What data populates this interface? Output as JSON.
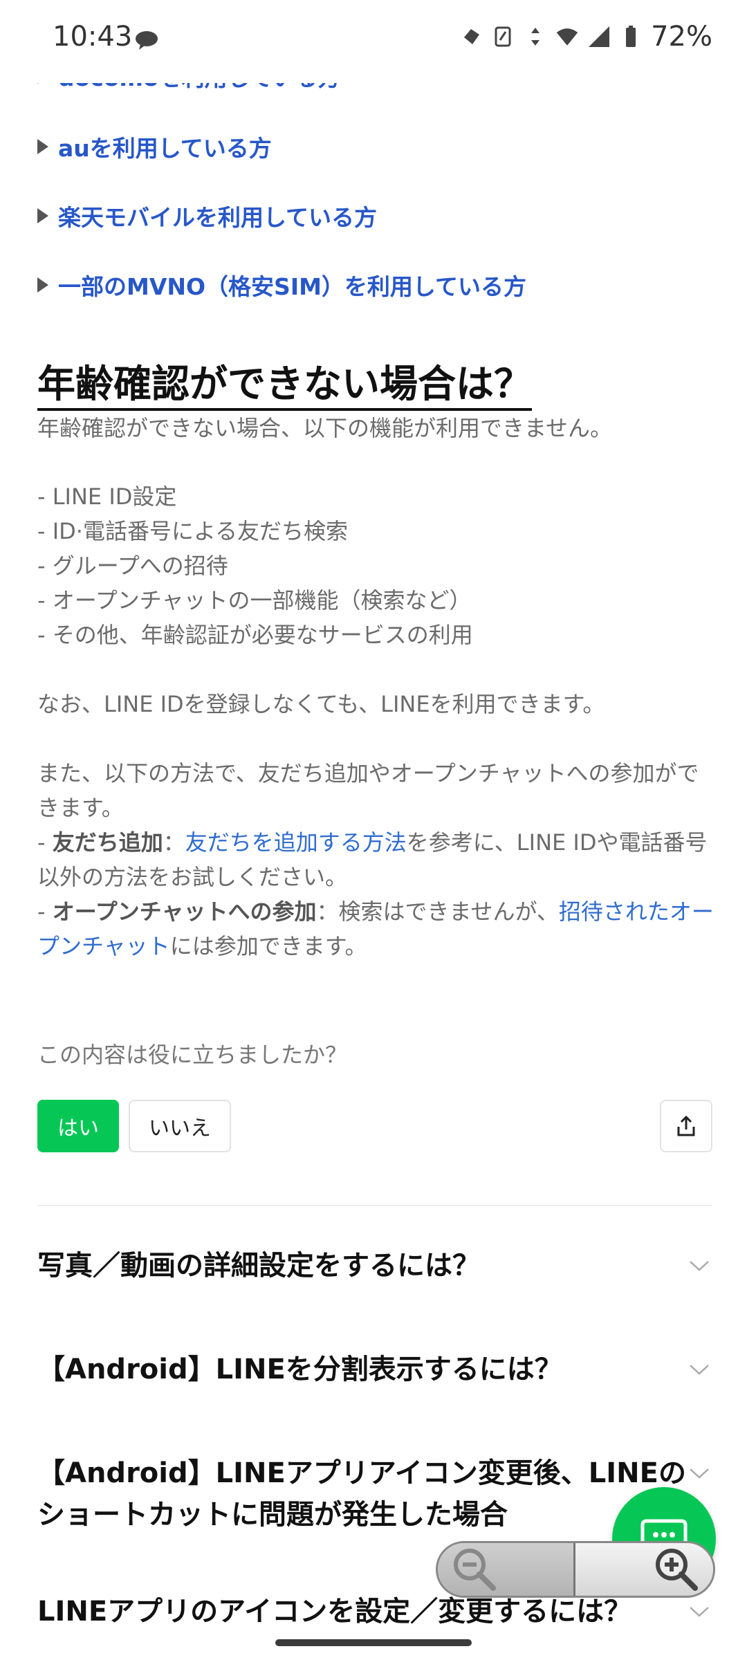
{
  "status_bar": {
    "time": "10:43",
    "battery": "72%"
  },
  "links": [
    "docomoを利用している方",
    "auを利用している方",
    "楽天モバイルを利用している方",
    "一部のMVNO（格安SIM）を利用している方"
  ],
  "section": {
    "title": "年齢確認ができない場合は？",
    "intro": "年齢確認ができない場合、以下の機能が利用できません。",
    "list": [
      "- LINE ID設定",
      "- ID·電話番号による友だち検索",
      "- グループへの招待",
      "- オープンチャットの一部機能（検索など）",
      "- その他、年齢認証が必要なサービスの利用"
    ],
    "note": "なお、LINE IDを登録しなくても、LINEを利用できます。",
    "para_1": "また、以下の方法で、友だち追加やオープンチャットへの参加ができます。",
    "friend_prefix": "- ",
    "friend_label": "友だち追加",
    "friend_colon": "：",
    "friend_link": "友だちを追加する方法",
    "friend_rest": "を参考に、LINE IDや電話番号以外の方法をお試しください。",
    "oc_prefix": "- ",
    "oc_label": "オープンチャットへの参加",
    "oc_rest": "：検索はできませんが、",
    "oc_link": "招待されたオープンチャット",
    "oc_tail": "には参加できます。"
  },
  "feedback": {
    "question": "この内容は役に立ちましたか？",
    "yes": "はい",
    "no": "いいえ"
  },
  "faq": [
    "写真／動画の詳細設定をするには？",
    "【Android】LINEを分割表示するには？",
    "【Android】LINEアプリアイコン変更後、LINEのショートカットに問題が発生した場合",
    "LINEアプリのアイコンを設定／変更するには？"
  ],
  "colors": {
    "link": "#2757c9",
    "accent": "#06c755"
  }
}
